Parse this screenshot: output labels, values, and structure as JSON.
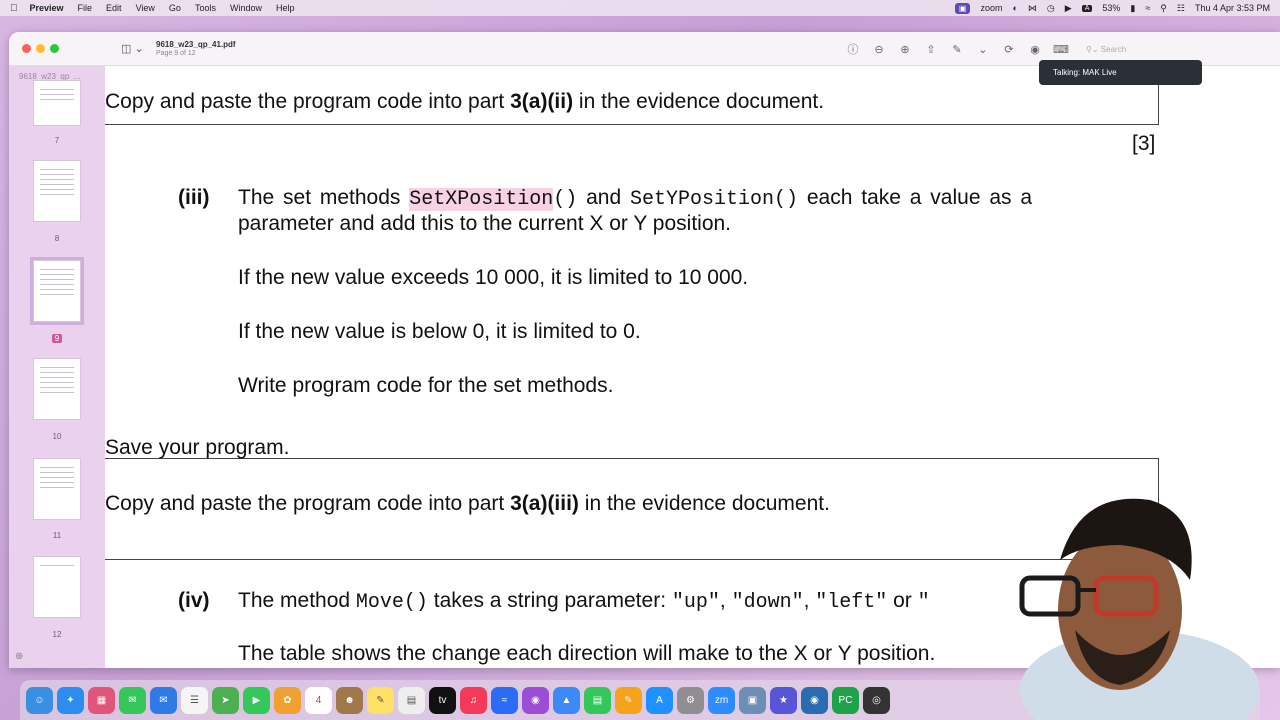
{
  "menubar": {
    "app_name": "Preview",
    "items": [
      "File",
      "Edit",
      "View",
      "Go",
      "Tools",
      "Window",
      "Help"
    ],
    "zoom_label": "zoom",
    "battery": "53%",
    "datetime": "Thu 4 Apr  3:53 PM"
  },
  "window": {
    "title": "9618_w23_qp_41.pdf",
    "subtitle": "Page 9 of 12",
    "search_placeholder": "Search"
  },
  "sidebar": {
    "file_name": "9618_w23_qp_...",
    "pages": [
      "7",
      "8",
      "9",
      "10",
      "11",
      "12"
    ],
    "selected_page": "9"
  },
  "zoom_tooltip": "Talking: MAK Live",
  "document": {
    "line1_pre": "Copy and paste the program code into part ",
    "line1_bold": "3(a)(ii)",
    "line1_post": " in the evidence document.",
    "marks": "[3]",
    "q3_label": "(iii)",
    "q3_text1": "The set methods ",
    "q3_code1": "SetXPosition",
    "q3_code1_parens": "()",
    "q3_text2": " and ",
    "q3_code2": "SetYPosition()",
    "q3_text3": " each take a value as a",
    "q3_line2": "parameter and add this to the current X or Y position.",
    "q3_para2": "If the new value exceeds 10 000, it is limited to 10 000.",
    "q3_para3": "If the new value is below 0, it is limited to 0.",
    "q3_para4": "Write program code for the set methods.",
    "save": "Save your program.",
    "line2_pre": "Copy and paste the program code into part ",
    "line2_bold": "3(a)(iii)",
    "line2_post": " in the evidence document.",
    "q4_label": "(iv)",
    "q4_text1": "The method ",
    "q4_code1": "Move()",
    "q4_text2": " takes a string parameter: ",
    "q4_code2": "\"up\"",
    "q4_sep1": ", ",
    "q4_code3": "\"down\"",
    "q4_sep2": ", ",
    "q4_code4": "\"left\"",
    "q4_text3": " or ",
    "q4_code5": "\"",
    "q4_line2": "The table shows the change each direction will make to the X or Y position."
  }
}
